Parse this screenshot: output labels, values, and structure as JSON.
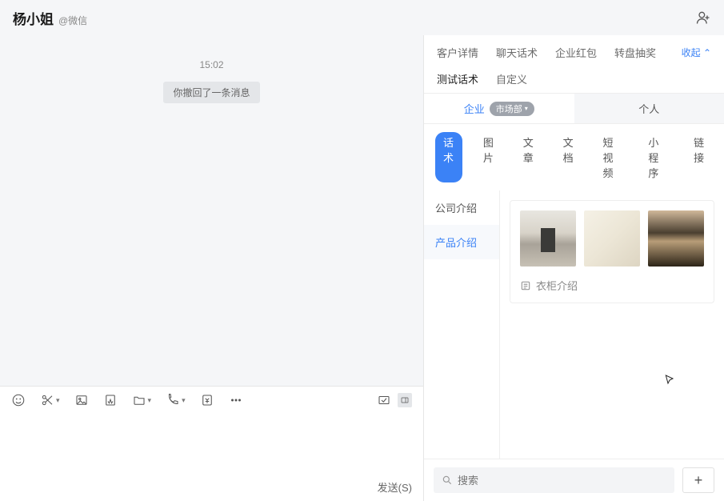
{
  "header": {
    "contact_name": "杨小姐",
    "source": "@微信"
  },
  "chat": {
    "time": "15:02",
    "recall_notice": "你撤回了一条消息"
  },
  "composer": {
    "send_label": "发送(S)"
  },
  "side": {
    "tabs1": {
      "a": "客户详情",
      "b": "聊天话术",
      "c": "企业红包",
      "d": "转盘抽奖",
      "collapse": "收起 ⌃"
    },
    "tabs2": {
      "a": "测试话术",
      "b": "自定义"
    },
    "owner": {
      "company": "企业",
      "dept_badge": "市场部",
      "personal": "个人"
    },
    "types": {
      "a": "话术",
      "b": "图片",
      "c": "文章",
      "d": "文档",
      "e": "短视频",
      "f": "小程序",
      "g": "链接"
    },
    "cats": {
      "a": "公司介绍",
      "b": "产品介绍"
    },
    "card": {
      "note": "衣柜介绍"
    },
    "search_placeholder": "搜索"
  }
}
